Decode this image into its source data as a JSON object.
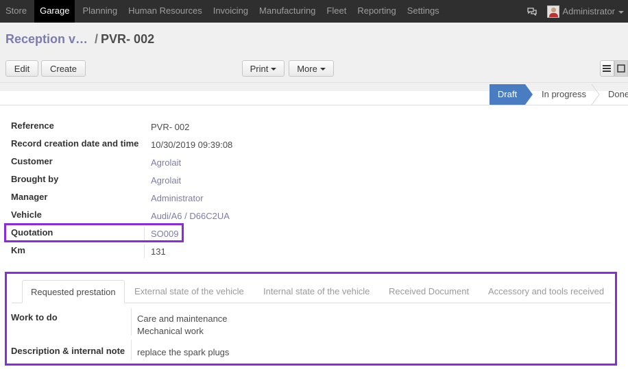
{
  "nav": {
    "items": [
      "Store",
      "Garage",
      "Planning",
      "Human Resources",
      "Invoicing",
      "Manufacturing",
      "Fleet",
      "Reporting",
      "Settings"
    ],
    "active": "Garage",
    "user": "Administrator"
  },
  "breadcrumb": {
    "parent": "Reception v…",
    "separator": "/",
    "current": "PVR- 002"
  },
  "toolbar": {
    "edit": "Edit",
    "create": "Create",
    "print": "Print",
    "more": "More"
  },
  "status": {
    "stages": [
      "Draft",
      "In progress",
      "Done"
    ],
    "current": "Draft"
  },
  "fields": [
    {
      "label": "Reference",
      "value": "PVR- 002",
      "link": false
    },
    {
      "label": "Record creation date and time",
      "value": "10/30/2019 09:39:08",
      "link": false
    },
    {
      "label": "Customer",
      "value": "Agrolait",
      "link": true
    },
    {
      "label": "Brought by",
      "value": "Agrolait",
      "link": true
    },
    {
      "label": "Manager",
      "value": "Administrator",
      "link": true
    },
    {
      "label": "Vehicle",
      "value": "Audi/A6 / D66C2UA",
      "link": true
    },
    {
      "label": "Quotation",
      "value": "SO009",
      "link": true
    },
    {
      "label": "Km",
      "value": "131",
      "link": false
    }
  ],
  "notebook": {
    "tabs": [
      "Requested prestation",
      "External state of the vehicle",
      "Internal state of the vehicle",
      "Received Document",
      "Accessory and tools received"
    ],
    "active": "Requested prestation",
    "work_to_do_label": "Work to do",
    "work_to_do": [
      "Care and maintenance",
      "Mechanical work"
    ],
    "description_label": "Description & internal note",
    "description": "replace the spark plugs"
  },
  "colors": {
    "highlight": "#8a2be2",
    "link": "#7c7bad",
    "status_active": "#4a7cc2"
  }
}
